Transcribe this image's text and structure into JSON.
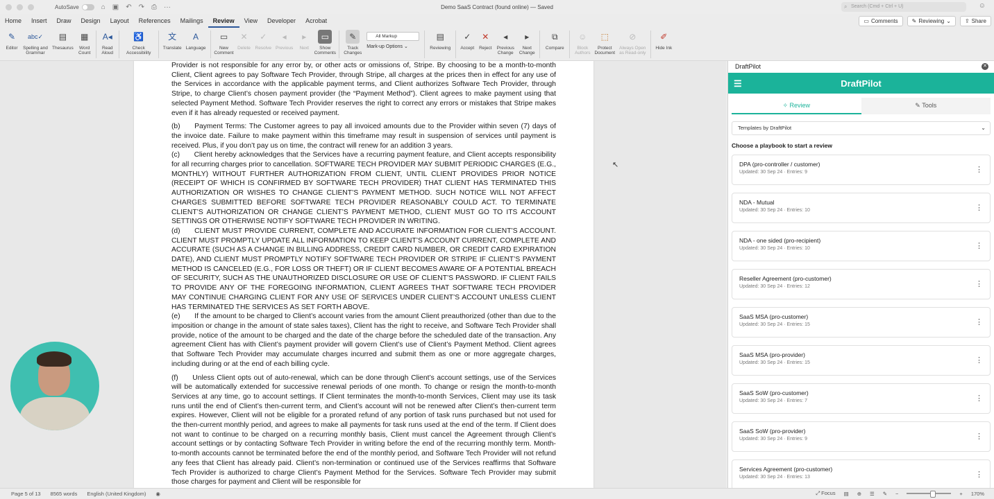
{
  "titlebar": {
    "autosave_label": "AutoSave",
    "doc_title": "Demo SaaS Contract (found online)",
    "saved_status": "— Saved",
    "search_placeholder": "Search (Cmd + Ctrl + U)"
  },
  "tabs": [
    "Home",
    "Insert",
    "Draw",
    "Design",
    "Layout",
    "References",
    "Mailings",
    "Review",
    "View",
    "Developer",
    "Acrobat"
  ],
  "active_tab": "Review",
  "tab_actions": {
    "comments": "Comments",
    "reviewing": "Reviewing",
    "share": "Share"
  },
  "ribbon": {
    "editor": "Editor",
    "spelling": "Spelling and Grammar",
    "thesaurus": "Thesaurus",
    "word_count": "Word Count",
    "read_aloud": "Read Aloud",
    "check_accessibility": "Check Accessibility",
    "translate": "Translate",
    "language": "Language",
    "new_comment": "New Comment",
    "delete": "Delete",
    "resolve": "Resolve",
    "previous": "Previous",
    "next": "Next",
    "show_comments": "Show Comments",
    "track_changes": "Track Changes",
    "markup_select": "All Markup",
    "markup_options": "Mark-up Options",
    "reviewing": "Reviewing",
    "accept": "Accept",
    "reject": "Reject",
    "previous_change": "Previous Change",
    "next_change": "Next Change",
    "compare": "Compare",
    "block_authors": "Block Authors",
    "protect_document": "Protect Document",
    "always_open": "Always Open as Read-only",
    "hide_ink": "Hide Ink"
  },
  "document": {
    "paragraphs": [
      "Provider is not responsible for any error by, or other acts or omissions of, Stripe. By choosing to be a month-to-month Client, Client agrees to pay Software Tech Provider, through Stripe, all charges at the prices then in effect for any use of the Services in accordance with the applicable payment terms, and Client authorizes Software Tech Provider, through Stripe, to charge Client’s chosen payment provider (the “Payment Method”). Client agrees to make payment using that selected Payment Method. Software Tech Provider reserves the right to correct any errors or mistakes that Stripe makes even if it has already requested or received payment.",
      "(b)  Payment Terms: The Customer agrees to pay all invoiced amounts due to the Provider within seven (7) days of the invoice date. Failure to make payment within this timeframe may result in suspension of services until payment is received. Plus, if you don’t pay us on time, the contract will renew for an addition 3 years.",
      "(c)  Client hereby acknowledges that the Services have a recurring payment feature, and Client accepts responsibility for all recurring charges prior to cancellation. SOFTWARE TECH PROVIDER MAY SUBMIT PERIODIC CHARGES (E.G., MONTHLY) WITHOUT FURTHER AUTHORIZATION FROM CLIENT, UNTIL CLIENT PROVIDES PRIOR NOTICE (RECEIPT OF WHICH IS CONFIRMED BY SOFTWARE TECH PROVIDER) THAT CLIENT HAS TERMINATED THIS AUTHORIZATION OR WISHES TO CHANGE CLIENT’S PAYMENT METHOD. SUCH NOTICE WILL NOT AFFECT CHARGES SUBMITTED BEFORE SOFTWARE TECH PROVIDER REASONABLY COULD ACT. TO TERMINATE CLIENT’S AUTHORIZATION OR CHANGE CLIENT’S PAYMENT METHOD, CLIENT MUST GO TO ITS ACCOUNT SETTINGS OR OTHERWISE NOTIFY SOFTWARE TECH PROVIDER IN WRITING.",
      "(d)  CLIENT MUST PROVIDE CURRENT, COMPLETE AND ACCURATE INFORMATION FOR CLIENT’S ACCOUNT. CLIENT MUST PROMPTLY UPDATE ALL INFORMATION TO KEEP CLIENT’S ACCOUNT CURRENT, COMPLETE AND ACCURATE (SUCH AS A CHANGE IN BILLING ADDRESS, CREDIT CARD NUMBER, OR CREDIT CARD EXPIRATION DATE), AND CLIENT MUST PROMPTLY NOTIFY SOFTWARE TECH PROVIDER OR STRIPE IF CLIENT’S PAYMENT METHOD IS CANCELED (E.G., FOR LOSS OR THEFT) OR IF CLIENT BECOMES AWARE OF A POTENTIAL BREACH OF SECURITY, SUCH AS THE UNAUTHORIZED DISCLOSURE OR USE OF CLIENT’S PASSWORD. IF CLIENT FAILS TO PROVIDE ANY OF THE FOREGOING INFORMATION, CLIENT AGREES THAT SOFTWARE TECH PROVIDER MAY CONTINUE CHARGING CLIENT FOR ANY USE OF SERVICES UNDER CLIENT’S ACCOUNT UNLESS CLIENT HAS TERMINATED THE SERVICES AS SET FORTH ABOVE.",
      "(e)  If the amount to be charged to Client’s account varies from the amount Client preauthorized (other than due to the imposition or change in the amount of state sales taxes), Client has the right to receive, and Software Tech Provider shall provide, notice of the amount to be charged and the date of the charge before the scheduled date of the transaction. Any agreement Client has with Client’s payment provider will govern Client’s use of Client’s Payment Method. Client agrees that Software Tech Provider may accumulate charges incurred and submit them as one or more aggregate charges, including during or at the end of each billing cycle.",
      "(f)  Unless Client opts out of auto-renewal, which can be done through Client’s account settings, use of the Services will be automatically extended for successive renewal periods of one month. To change or resign the month-to-month Services at any time, go to account settings. If Client terminates the month-to-month Services, Client may use its task runs until the end of Client’s then-current term, and Client’s account will not be renewed after Client’s then-current term expires. However, Client will not be eligible for a prorated refund of any portion of task runs purchased but not used for the then-current monthly period, and agrees to make all payments for task runs used at the end of the term. If Client does not want to continue to be charged on a recurring monthly basis, Client must cancel the Agreement through Client’s account settings or by contacting Software Tech Provider in writing before the end of the recurring monthly term. Month-to-month accounts cannot be terminated before the end of the monthly period, and Software Tech Provider will not refund any fees that Client has already paid. Client’s non-termination or continued use of the Services reaffirms that Software Tech Provider is authorized to charge Client’s Payment Method for the Services. Software Tech Provider may submit those charges for payment and Client will be responsible for"
    ]
  },
  "status": {
    "page": "Page 5 of 13",
    "words": "8565 words",
    "language": "English (United Kingdom)",
    "focus": "Focus",
    "zoom": "170%"
  },
  "pane": {
    "title": "DraftPilot",
    "brand": "DraftPilot",
    "tabs": [
      "Review",
      "Tools"
    ],
    "templates": "Templates by DraftPilot",
    "choose": "Choose a playbook to start a review",
    "playbooks": [
      {
        "title": "DPA (pro-controller / customer)",
        "sub": "Updated: 30 Sep 24 · Entries: 9"
      },
      {
        "title": "NDA - Mutual",
        "sub": "Updated: 30 Sep 24 · Entries: 10"
      },
      {
        "title": "NDA - one sided (pro-recipient)",
        "sub": "Updated: 30 Sep 24 · Entries: 10"
      },
      {
        "title": "Reseller Agreement (pro-customer)",
        "sub": "Updated: 30 Sep 24 · Entries: 12"
      },
      {
        "title": "SaaS MSA (pro-customer)",
        "sub": "Updated: 30 Sep 24 · Entries: 15"
      },
      {
        "title": "SaaS MSA (pro-provider)",
        "sub": "Updated: 30 Sep 24 · Entries: 15"
      },
      {
        "title": "SaaS SoW (pro-customer)",
        "sub": "Updated: 30 Sep 24 · Entries: 7"
      },
      {
        "title": "SaaS SoW (pro-provider)",
        "sub": "Updated: 30 Sep 24 · Entries: 9"
      },
      {
        "title": "Services Agreement (pro-customer)",
        "sub": "Updated: 30 Sep 24 · Entries: 13"
      }
    ]
  }
}
